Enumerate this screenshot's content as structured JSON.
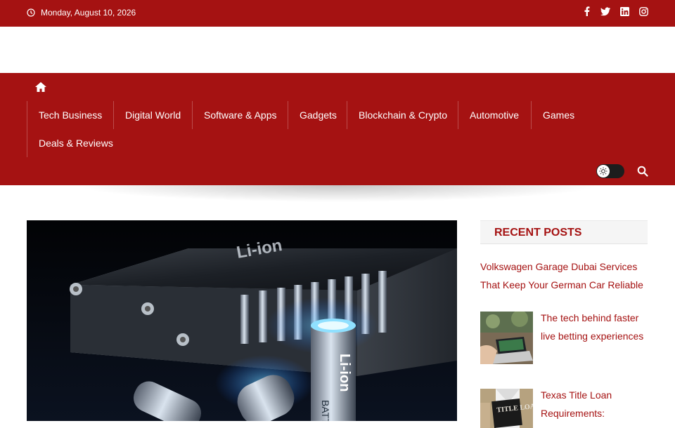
{
  "topbar": {
    "date": "Monday, August 10, 2026",
    "social": [
      "facebook-icon",
      "twitter-icon",
      "linkedin-icon",
      "instagram-icon"
    ]
  },
  "nav": {
    "items": [
      {
        "label": "Tech Business"
      },
      {
        "label": "Digital World"
      },
      {
        "label": "Software & Apps"
      },
      {
        "label": "Gadgets"
      },
      {
        "label": "Blockchain & Crypto"
      },
      {
        "label": "Automotive"
      },
      {
        "label": "Games"
      },
      {
        "label": "Deals & Reviews"
      }
    ]
  },
  "hero": {
    "cell_label": "Li-ion",
    "cell_sub": "BATTERY"
  },
  "sidebar": {
    "heading": "RECENT POSTS",
    "posts": [
      {
        "title": "Volkswagen Garage Dubai Services That Keep Your German Car Reliable"
      },
      {
        "title": "The tech behind faster live betting experiences"
      },
      {
        "title": "Texas Title Loan Requirements:",
        "thumb_text": "TITLE LOAN"
      }
    ]
  },
  "colors": {
    "brand": "#a51212",
    "white": "#ffffff"
  }
}
